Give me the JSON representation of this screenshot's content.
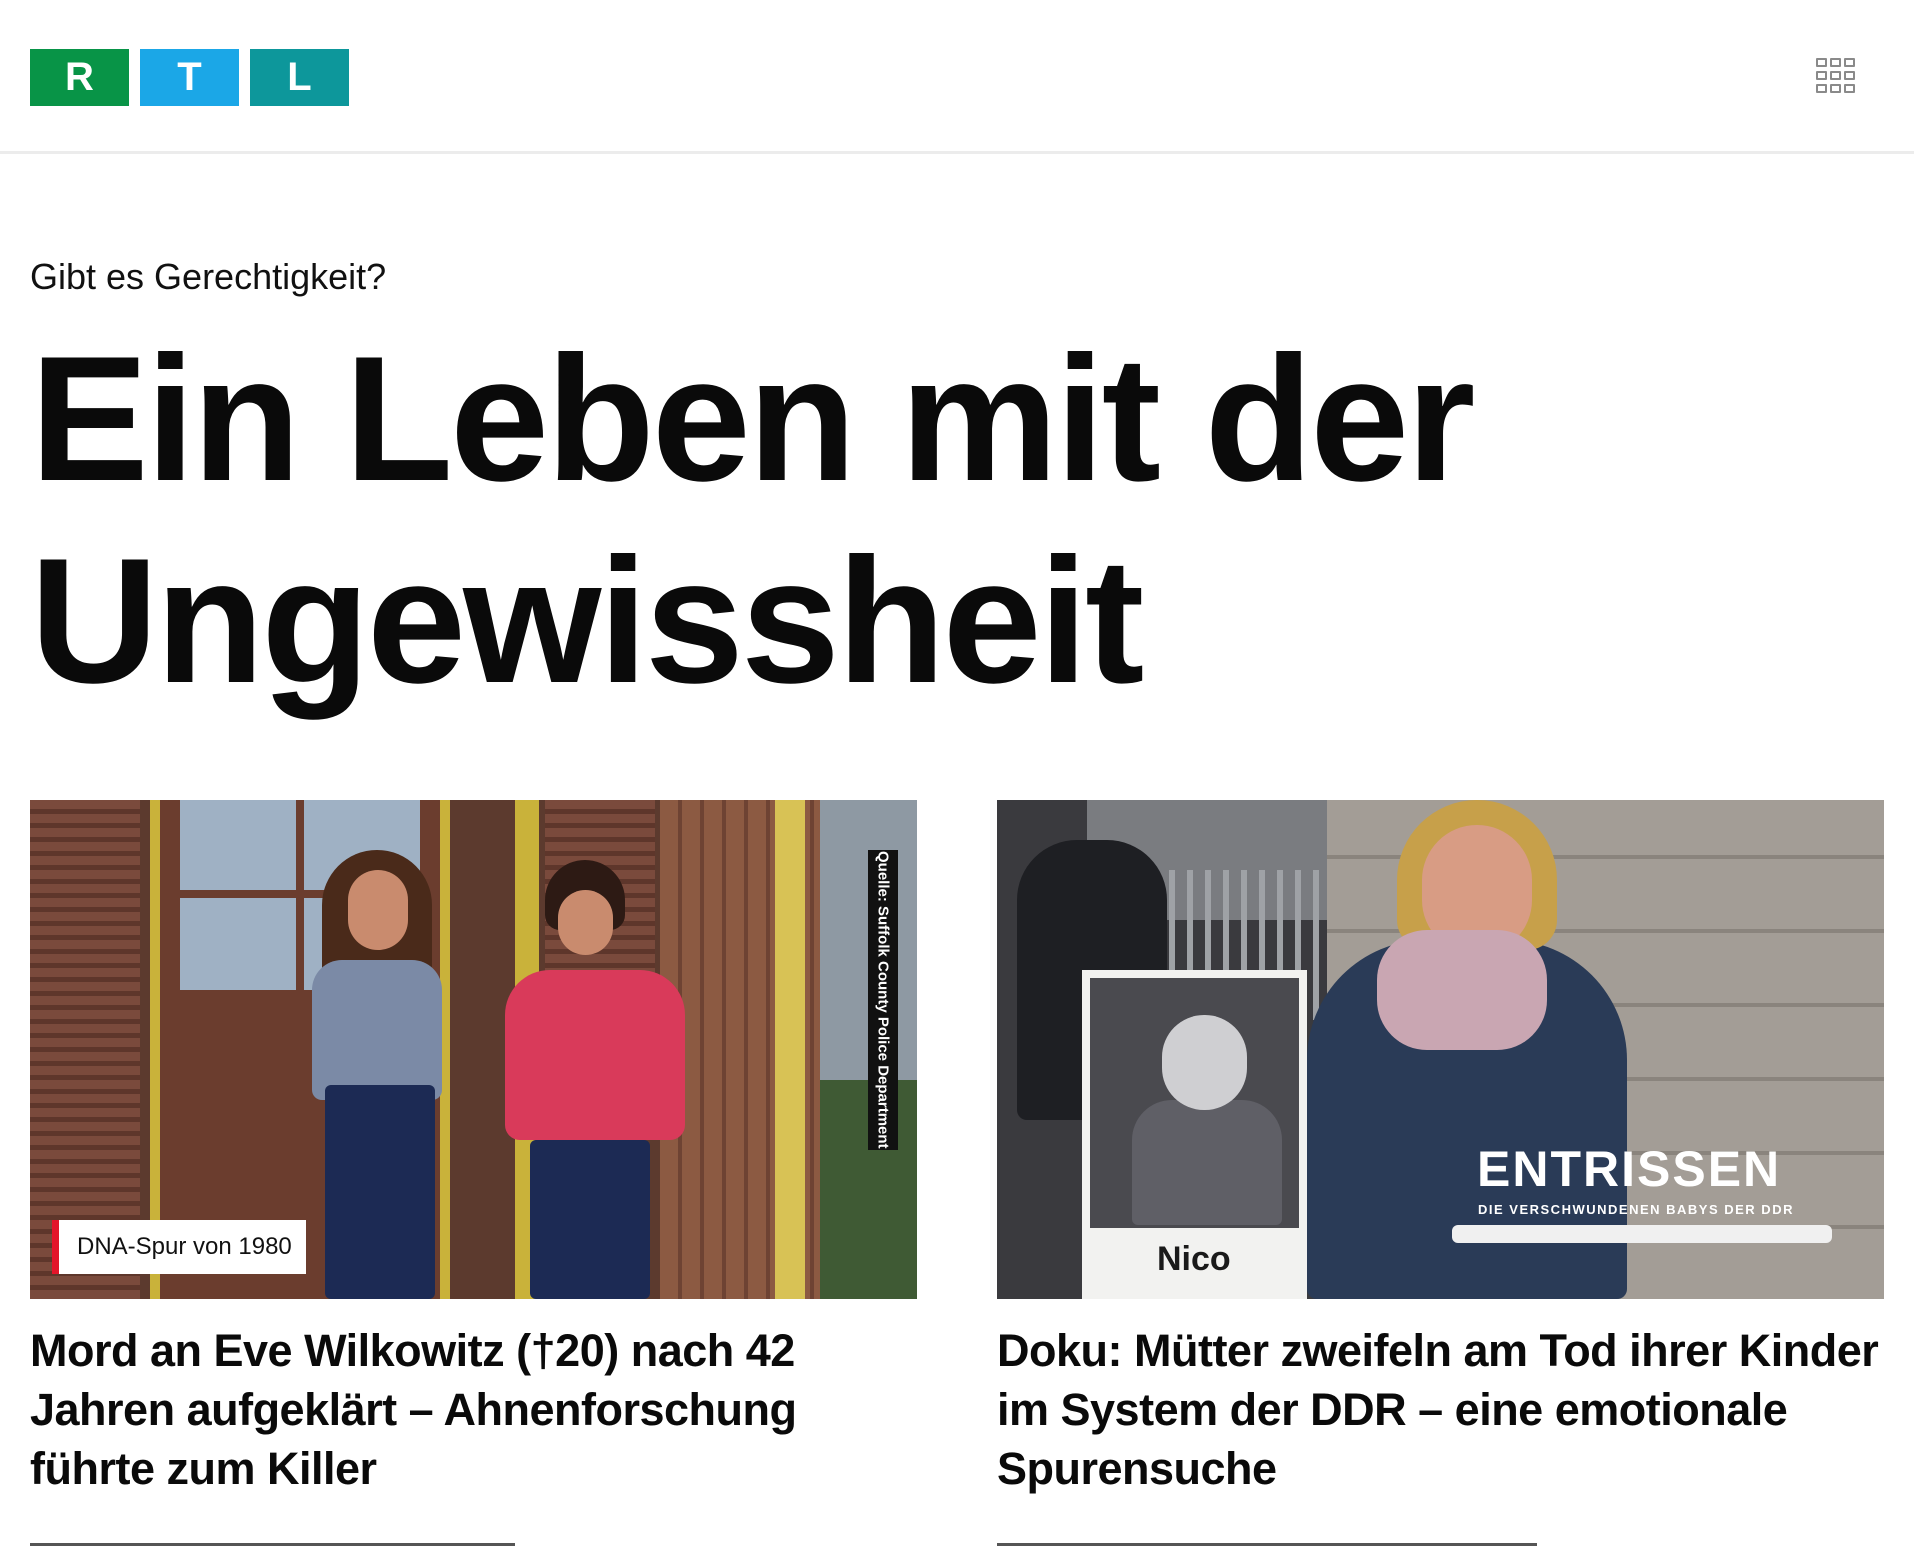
{
  "header": {
    "logo_letters": [
      "R",
      "T",
      "L"
    ],
    "brand_colors": {
      "r": "#089447",
      "t": "#1ba7e7",
      "l": "#0d979b"
    },
    "menu_icon": "grid-menu-icon"
  },
  "section": {
    "kicker": "Gibt es Gerechtigkeit?",
    "headline_line1": "Ein Leben mit der",
    "headline_line2": "Ungewissheit"
  },
  "cards": [
    {
      "badge": "DNA-Spur von 1980",
      "badge_color": "#e3152a",
      "image_credit": "Quelle: Suffolk County Police Department",
      "title": "Mord an Eve Wilkowitz (†20) nach 42 Jahren aufgeklärt – Ahnenforschung führte zum Killer"
    },
    {
      "image_title": "ENTRISSEN",
      "image_subtitle": "DIE VERSCHWUNDENEN BABYS DER DDR",
      "image_sign_name": "Nico",
      "title": "Doku: Mütter zweifeln am Tod ihrer Kinder im System der DDR – eine emotionale Spurensuche"
    }
  ]
}
